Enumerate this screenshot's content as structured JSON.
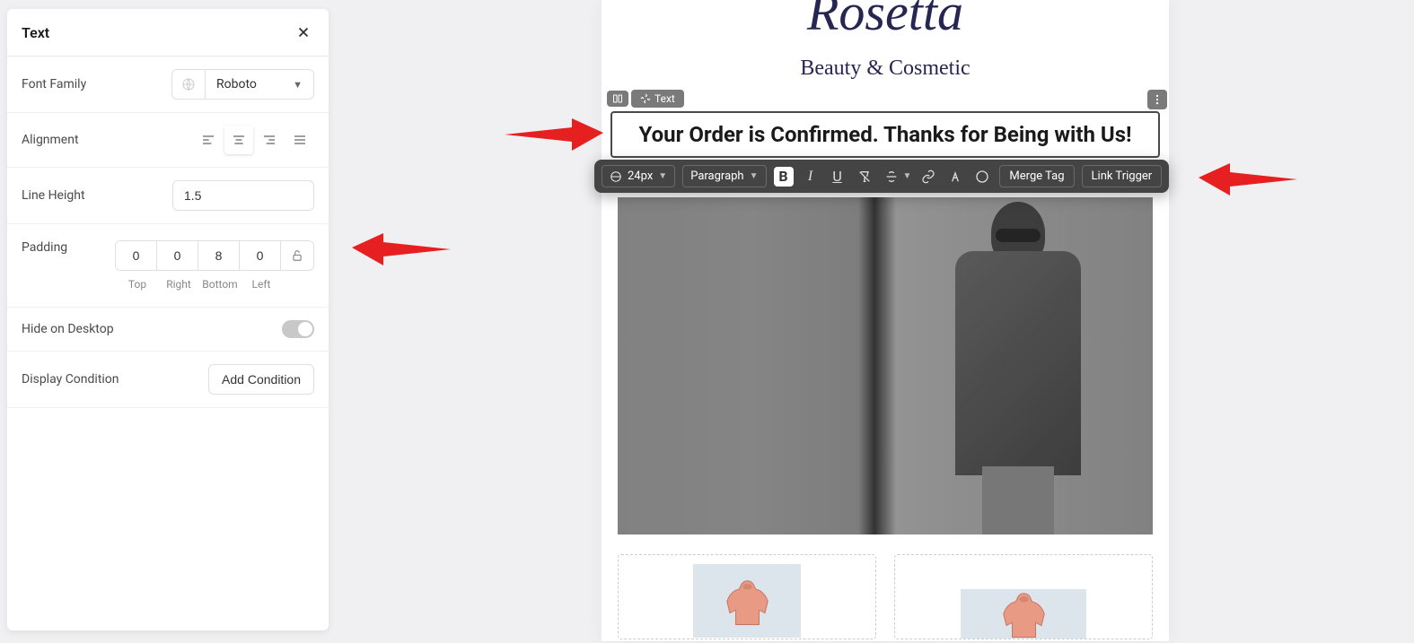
{
  "panel": {
    "title": "Text",
    "fontFamily": {
      "label": "Font Family",
      "value": "Roboto"
    },
    "alignment": {
      "label": "Alignment",
      "active": "center"
    },
    "lineHeight": {
      "label": "Line Height",
      "value": "1.5"
    },
    "padding": {
      "label": "Padding",
      "top": "0",
      "right": "0",
      "bottom": "8",
      "left": "0",
      "labels": {
        "top": "Top",
        "right": "Right",
        "bottom": "Bottom",
        "left": "Left"
      }
    },
    "hideOnDesktop": {
      "label": "Hide on Desktop",
      "value": false
    },
    "displayCondition": {
      "label": "Display Condition",
      "buttonLabel": "Add Condition"
    }
  },
  "canvas": {
    "brandName": "Rosetta",
    "brandTagline": "Beauty & Cosmetic",
    "elementBadge": "Text",
    "selectedText": "Your Order is Confirmed. Thanks for Being with Us!"
  },
  "toolbar": {
    "fontSize": "24px",
    "paragraph": "Paragraph",
    "mergeTag": "Merge Tag",
    "linkTrigger": "Link Trigger"
  }
}
